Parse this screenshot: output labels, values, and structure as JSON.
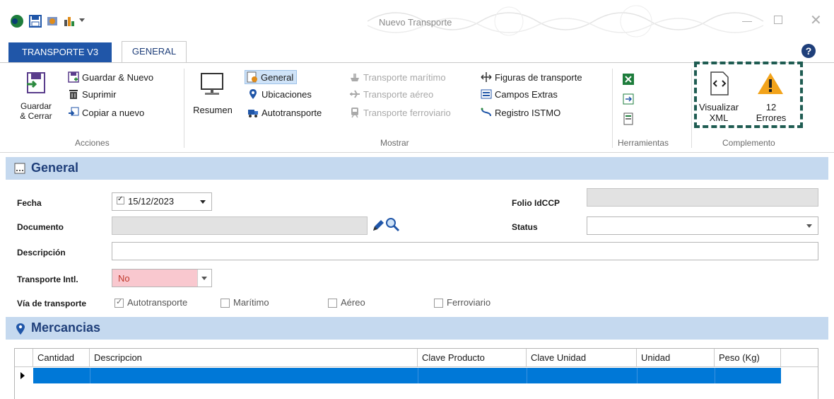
{
  "window": {
    "title": "Nuevo Transporte"
  },
  "tabs": {
    "main": "TRANSPORTE V3",
    "general": "GENERAL"
  },
  "ribbon": {
    "acciones": {
      "guardar_cerrar_l1": "Guardar",
      "guardar_cerrar_l2": "& Cerrar",
      "guardar_nuevo": "Guardar & Nuevo",
      "suprimir": "Suprimir",
      "copiar": "Copiar a nuevo",
      "group": "Acciones"
    },
    "mostrar": {
      "resumen": "Resumen",
      "general": "General",
      "ubicaciones": "Ubicaciones",
      "autotransporte": "Autotransporte",
      "maritimo": "Transporte marítimo",
      "aereo": "Transporte aéreo",
      "ferroviario": "Transporte ferroviario",
      "figuras": "Figuras de transporte",
      "campos": "Campos Extras",
      "istmo": "Registro ISTMO",
      "group": "Mostrar"
    },
    "herramientas": {
      "group": "Herramientas"
    },
    "complemento": {
      "xml_l1": "Visualizar",
      "xml_l2": "XML",
      "errores_count": "12",
      "errores_label": "Errores",
      "group": "Complemento"
    }
  },
  "general": {
    "title": "General",
    "fecha_label": "Fecha",
    "fecha_value": "15/12/2023",
    "folio_label": "Folio IdCCP",
    "folio_value": "",
    "documento_label": "Documento",
    "status_label": "Status",
    "status_value": "",
    "descripcion_label": "Descripción",
    "transporte_intl_label": "Transporte Intl.",
    "transporte_intl_value": "No",
    "via_label": "Vía de transporte",
    "via_options": [
      {
        "label": "Autotransporte",
        "checked": true
      },
      {
        "label": "Marítimo",
        "checked": false
      },
      {
        "label": "Aéreo",
        "checked": false
      },
      {
        "label": "Ferroviario",
        "checked": false
      }
    ]
  },
  "mercancias": {
    "title": "Mercancias",
    "columns": [
      "Cantidad",
      "Descripcion",
      "Clave Producto",
      "Clave Unidad",
      "Unidad",
      "Peso (Kg)"
    ]
  }
}
